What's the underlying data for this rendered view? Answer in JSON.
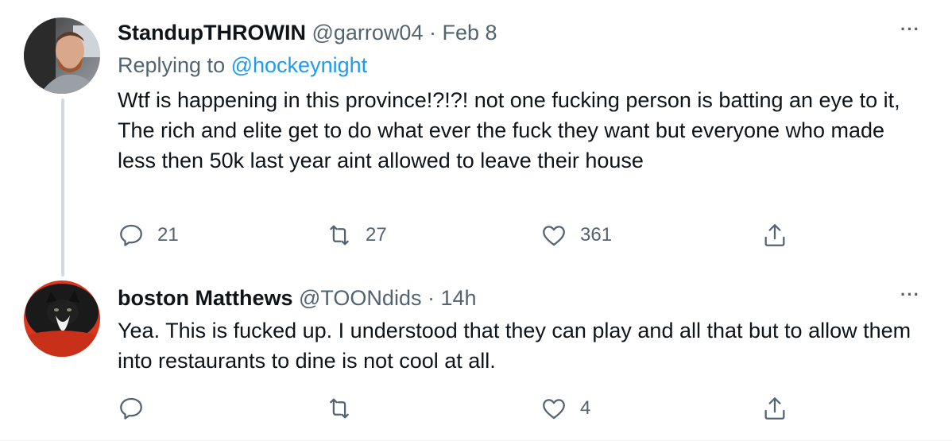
{
  "tweets": [
    {
      "display_name": "StandupTHROWIN",
      "handle": "@garrow04",
      "separator": "·",
      "time": "Feb 8",
      "more_label": "···",
      "replying_prefix": "Replying to",
      "replying_to": "@hockeynight",
      "text": "Wtf is happening in this province!?!?! not one fucking person is batting an eye to it, The rich and elite get to do what ever the fuck they want but everyone who made less then 50k last year aint allowed to leave their house",
      "counts": {
        "reply": "21",
        "retweet": "27",
        "like": "361"
      }
    },
    {
      "display_name": "boston Matthews",
      "handle": "@TOONdids",
      "separator": "·",
      "time": "14h",
      "more_label": "···",
      "text": "Yea.  This is fucked up.  I understood that they can play and all that but to allow them into restaurants to dine is not cool at all.",
      "counts": {
        "reply": "",
        "retweet": "",
        "like": "4"
      }
    }
  ],
  "icons": {
    "reply": "reply-icon",
    "retweet": "retweet-icon",
    "like": "heart-icon",
    "share": "share-icon"
  },
  "colors": {
    "text": "#0f1419",
    "secondary": "#536471",
    "link": "#1d9bf0",
    "thread_line": "#cfd9de"
  }
}
